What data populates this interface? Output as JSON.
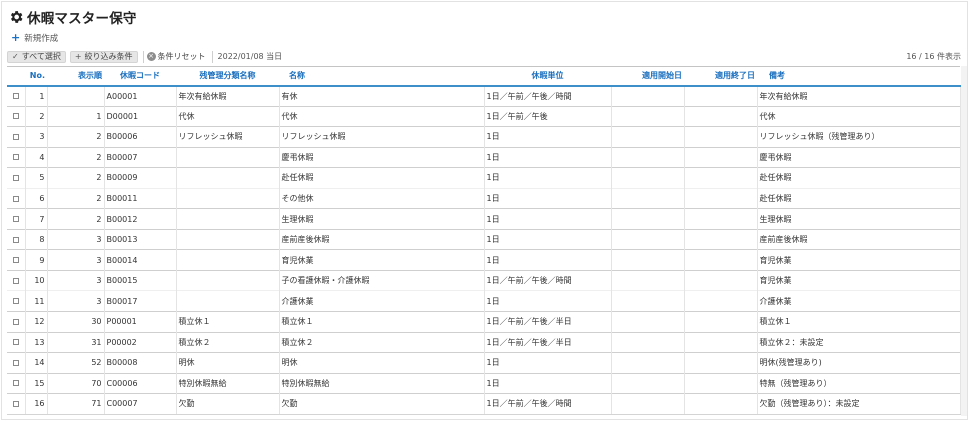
{
  "header": {
    "title": "休暇マスター保守",
    "title_icon": "gear-icon"
  },
  "actions": {
    "new_label": "新規作成"
  },
  "toolbar": {
    "select_all_label": "すべて選択",
    "filter_label": "絞り込み条件",
    "reset_label": "条件リセット",
    "date_text": "2022/01/08 当日",
    "count_text": "16 / 16 件表示"
  },
  "table": {
    "columns": [
      "No.",
      "表示順",
      "休暇コード",
      "残管理分類名称",
      "名称",
      "休暇単位",
      "適用開始日",
      "適用終了日",
      "備考"
    ],
    "rows": [
      {
        "no": "1",
        "order": "",
        "code": "A00001",
        "category": "年次有給休暇",
        "name": "有休",
        "unit": "1日／午前／午後／時間",
        "start": "",
        "end": "",
        "note": "年次有給休暇"
      },
      {
        "no": "2",
        "order": "1",
        "code": "D00001",
        "category": "代休",
        "name": "代休",
        "unit": "1日／午前／午後",
        "start": "",
        "end": "",
        "note": "代休"
      },
      {
        "no": "3",
        "order": "2",
        "code": "B00006",
        "category": "リフレッシュ休暇",
        "name": "リフレッシュ休暇",
        "unit": "1日",
        "start": "",
        "end": "",
        "note": "リフレッシュ休暇（残管理あり）"
      },
      {
        "no": "4",
        "order": "2",
        "code": "B00007",
        "category": "",
        "name": "慶弔休暇",
        "unit": "1日",
        "start": "",
        "end": "",
        "note": "慶弔休暇"
      },
      {
        "no": "5",
        "order": "2",
        "code": "B00009",
        "category": "",
        "name": "赴任休暇",
        "unit": "1日",
        "start": "",
        "end": "",
        "note": "赴任休暇"
      },
      {
        "no": "6",
        "order": "2",
        "code": "B00011",
        "category": "",
        "name": "その他休",
        "unit": "1日",
        "start": "",
        "end": "",
        "note": "赴任休暇"
      },
      {
        "no": "7",
        "order": "2",
        "code": "B00012",
        "category": "",
        "name": "生理休暇",
        "unit": "1日",
        "start": "",
        "end": "",
        "note": "生理休暇"
      },
      {
        "no": "8",
        "order": "3",
        "code": "B00013",
        "category": "",
        "name": "産前産後休暇",
        "unit": "1日",
        "start": "",
        "end": "",
        "note": "産前産後休暇"
      },
      {
        "no": "9",
        "order": "3",
        "code": "B00014",
        "category": "",
        "name": "育児休業",
        "unit": "1日",
        "start": "",
        "end": "",
        "note": "育児休業"
      },
      {
        "no": "10",
        "order": "3",
        "code": "B00015",
        "category": "",
        "name": "子の看護休暇・介護休暇",
        "unit": "1日／午前／午後／時間",
        "start": "",
        "end": "",
        "note": "育児休業"
      },
      {
        "no": "11",
        "order": "3",
        "code": "B00017",
        "category": "",
        "name": "介護休業",
        "unit": "1日",
        "start": "",
        "end": "",
        "note": "介護休業"
      },
      {
        "no": "12",
        "order": "30",
        "code": "P00001",
        "category": "積立休１",
        "name": "積立休１",
        "unit": "1日／午前／午後／半日",
        "start": "",
        "end": "",
        "note": "積立休１"
      },
      {
        "no": "13",
        "order": "31",
        "code": "P00002",
        "category": "積立休２",
        "name": "積立休２",
        "unit": "1日／午前／午後／半日",
        "start": "",
        "end": "",
        "note": "積立休２：未設定"
      },
      {
        "no": "14",
        "order": "52",
        "code": "B00008",
        "category": "明休",
        "name": "明休",
        "unit": "1日",
        "start": "",
        "end": "",
        "note": "明休(残管理あり)"
      },
      {
        "no": "15",
        "order": "70",
        "code": "C00006",
        "category": "特別休暇無給",
        "name": "特別休暇無給",
        "unit": "1日",
        "start": "",
        "end": "",
        "note": "特無（残管理あり）"
      },
      {
        "no": "16",
        "order": "71",
        "code": "C00007",
        "category": "欠勤",
        "name": "欠勤",
        "unit": "1日／午前／午後／時間",
        "start": "",
        "end": "",
        "note": "欠勤（残管理あり）：未設定"
      }
    ]
  },
  "colors": {
    "header_text": "#1a6fbf",
    "accent": "#3c8fc9",
    "plus": "#1a73c8"
  }
}
